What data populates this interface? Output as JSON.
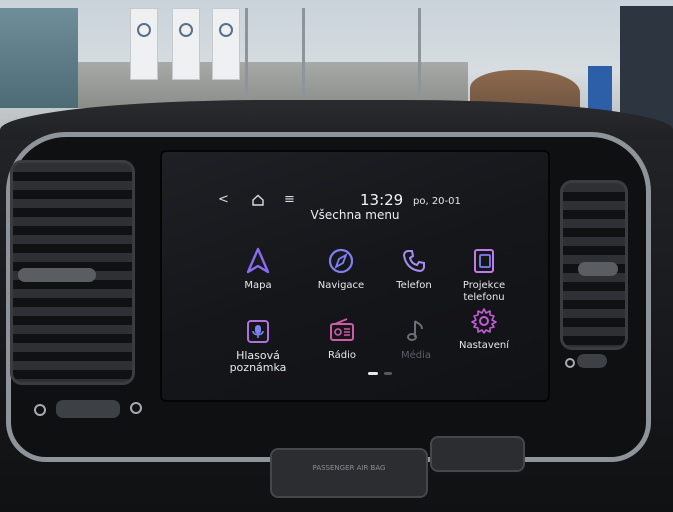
{
  "statusbar": {
    "back_glyph": "<",
    "menu_glyph": "≡",
    "time": "13:29",
    "date": "po, 20-01"
  },
  "screen_title": "Všechna menu",
  "apps": [
    {
      "label": "Mapa",
      "icon": "map-arrow-icon",
      "color": "#8a6cf2"
    },
    {
      "label": "Navigace",
      "icon": "compass-icon",
      "color": "#7e7ff0"
    },
    {
      "label": "Telefon",
      "icon": "phone-icon",
      "color": "#a78cf4"
    },
    {
      "label": "Projekce telefonu",
      "icon": "phone-projection-icon",
      "color": "#c27be8"
    },
    {
      "label": "Hlasová poznámka",
      "icon": "voice-memo-icon",
      "color": "#b16ee0"
    },
    {
      "label": "Rádio",
      "icon": "radio-icon",
      "color": "#cf5aa8"
    },
    {
      "label": "Média",
      "icon": "music-note-icon",
      "color": "#6b6e76"
    },
    {
      "label": "Nastavení",
      "icon": "gear-icon",
      "color": "#c35ad6"
    }
  ],
  "pager": {
    "pages": 2,
    "active": 1
  },
  "console": {
    "airbag_label": "PASSENGER AIR BAG"
  }
}
